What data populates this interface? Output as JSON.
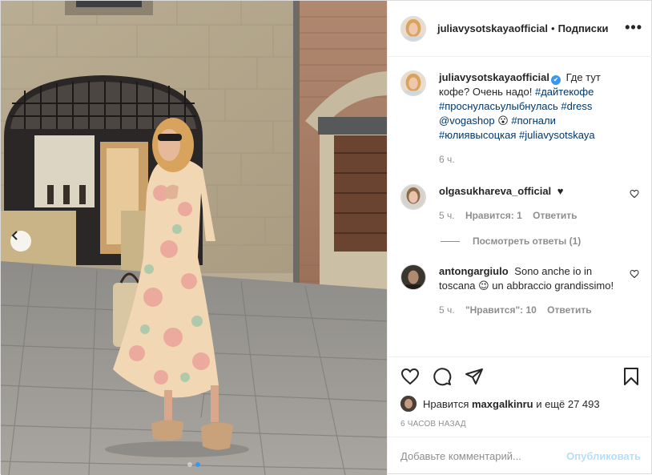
{
  "post": {
    "username": "juliavysotskayaofficial",
    "separator": "•",
    "follow_label": "Подписки",
    "more_label": "•••",
    "caption": {
      "username": "juliavysotskayaofficial",
      "text_before": "Где тут кофе? Очень надо!",
      "tags_1": "#дайтекофе #проснуласьулыбнулась #dress @vogashop",
      "emoji": "😮",
      "tags_2": "#погнали #юлиявысоцкая #juliavysotskaya",
      "time": "6 ч."
    },
    "comments": [
      {
        "username": "olgasukhareva_official",
        "text": "♥",
        "time": "5 ч.",
        "likes": "Нравится: 1",
        "reply": "Ответить",
        "view_replies": "Посмотреть ответы (1)"
      },
      {
        "username": "antongargiulo",
        "text": "Sono anche io in toscana 😉 un abbraccio grandissimo!",
        "time": "5 ч.",
        "likes": "\"Нравится\": 10",
        "reply": "Ответить"
      }
    ],
    "likes": {
      "prefix": "Нравится",
      "user": "maxgalkinru",
      "suffix": "и ещё 27 493"
    },
    "timestamp": "6 часов назад",
    "add_comment": {
      "placeholder": "Добавьте комментарий...",
      "submit_label": "Опубликовать"
    },
    "colors": {
      "accent": "#3897f0",
      "link": "#00376b",
      "muted": "#8e8e8e",
      "publish_disabled": "#b2dffc"
    },
    "icons": [
      "heart-icon",
      "comment-icon",
      "share-icon",
      "bookmark-icon",
      "chevron-left-icon",
      "verified-icon"
    ]
  }
}
